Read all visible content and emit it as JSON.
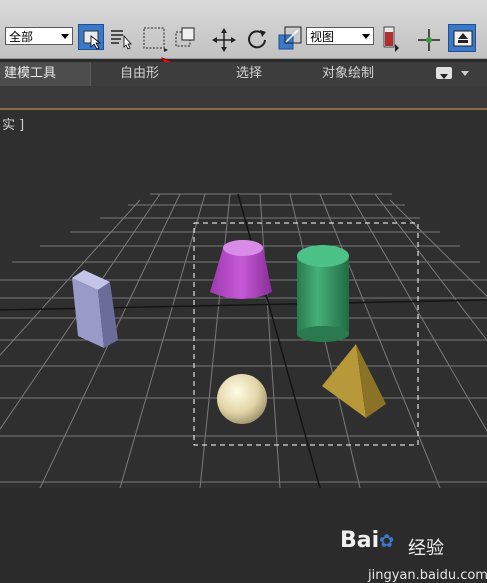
{
  "toolbar": {
    "filter_select": "全部",
    "view_select": "视图"
  },
  "tabs": [
    {
      "label": "建模工具"
    },
    {
      "label": "自由形"
    },
    {
      "label": "选择"
    },
    {
      "label": "对象绘制"
    }
  ],
  "viewport": {
    "label": "实 ]"
  },
  "watermark": {
    "brand": "Bai",
    "brand_suffix": "经验",
    "url": "jingyan.baidu.com"
  },
  "colors": {
    "active_blue": "#3a78c9",
    "cone": "#b548c8",
    "cylinder": "#3aa46a",
    "box": "#9a9ac8",
    "pyramid": "#c8a94a",
    "sphere": "#e8dfb8",
    "cursor_arrow": "#e01010"
  }
}
